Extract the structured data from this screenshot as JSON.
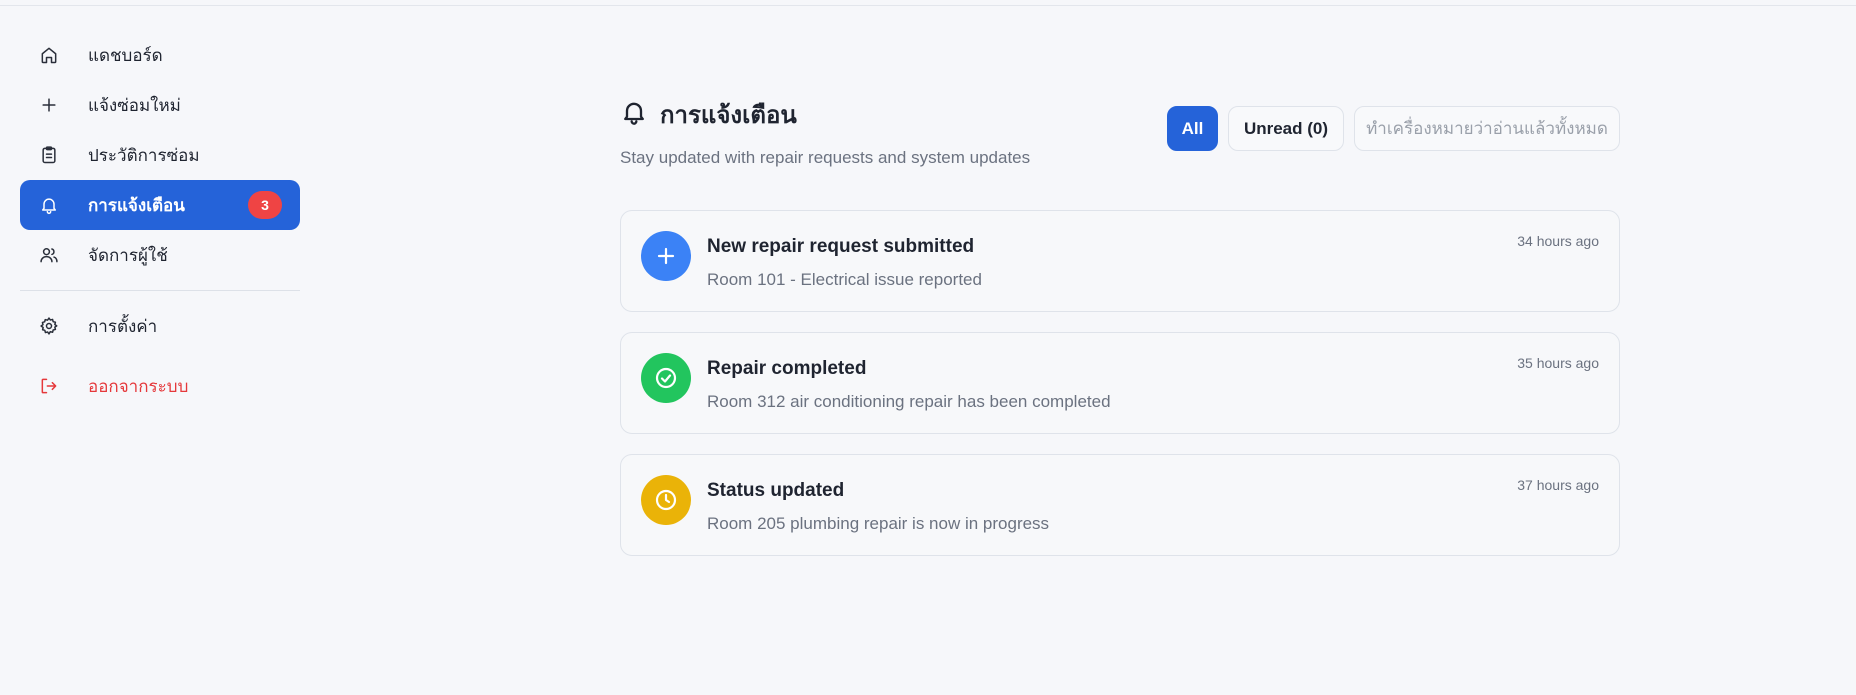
{
  "sidebar": {
    "items": [
      {
        "label": "แดชบอร์ด",
        "icon": "home-icon"
      },
      {
        "label": "แจ้งซ่อมใหม่",
        "icon": "plus-icon"
      },
      {
        "label": "ประวัติการซ่อม",
        "icon": "clipboard-icon"
      },
      {
        "label": "การแจ้งเตือน",
        "icon": "bell-icon",
        "badge": "3",
        "active": true
      },
      {
        "label": "จัดการผู้ใช้",
        "icon": "users-icon"
      }
    ],
    "settings_label": "การตั้งค่า",
    "logout_label": "ออกจากระบบ"
  },
  "header": {
    "title": "การแจ้งเตือน",
    "subtitle": "Stay updated with repair requests and system updates"
  },
  "filters": {
    "all_label": "All",
    "unread_label": "Unread (0)",
    "mark_all_label": "ทำเครื่องหมายว่าอ่านแล้วทั้งหมด"
  },
  "notifications": [
    {
      "title": "New repair request submitted",
      "message": "Room 101 - Electrical issue reported",
      "time": "34 hours ago",
      "icon": "plus-icon",
      "color": "#3b82f6"
    },
    {
      "title": "Repair completed",
      "message": "Room 312 air conditioning repair has been completed",
      "time": "35 hours ago",
      "icon": "check-circle-icon",
      "color": "#22c55e"
    },
    {
      "title": "Status updated",
      "message": "Room 205 plumbing repair is now in progress",
      "time": "37 hours ago",
      "icon": "clock-icon",
      "color": "#eab308"
    }
  ],
  "colors": {
    "accent": "#2563d9",
    "badge": "#ef4444",
    "logout": "#e5383b"
  }
}
